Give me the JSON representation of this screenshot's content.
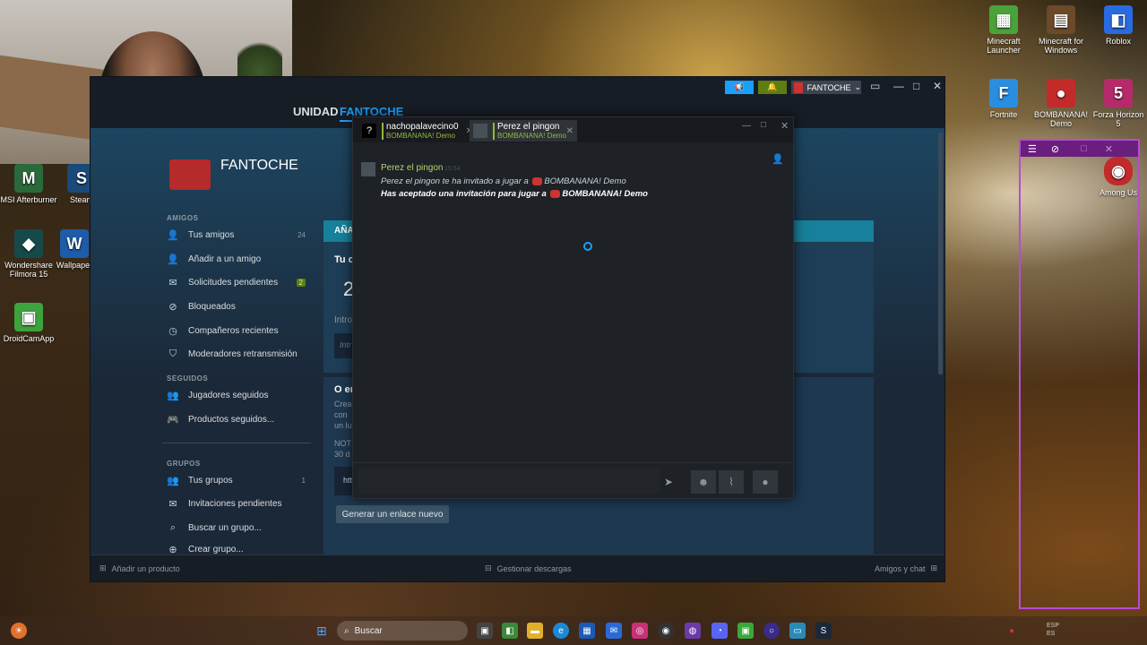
{
  "desktop": {
    "icons_left": [
      {
        "label": "MSI Afterburner",
        "icon": "msi-afterburner-icon"
      },
      {
        "label": "Steam",
        "icon": "steam-icon"
      },
      {
        "label": "Wondershare Filmora 15",
        "icon": "filmora-icon"
      },
      {
        "label": "Wallpaper",
        "icon": "wallpaper-engine-icon"
      },
      {
        "label": "DroidCamApp",
        "icon": "droidcam-icon"
      }
    ],
    "icons_right": [
      {
        "label": "Minecraft Launcher",
        "icon": "minecraft-launcher-icon"
      },
      {
        "label": "Minecraft for Windows",
        "icon": "minecraft-windows-icon"
      },
      {
        "label": "Roblox",
        "icon": "roblox-icon"
      },
      {
        "label": "Fortnite",
        "icon": "fortnite-icon"
      },
      {
        "label": "BOMBANANA! Demo",
        "icon": "bombanana-icon"
      },
      {
        "label": "Forza Horizon 5",
        "icon": "forza-icon"
      },
      {
        "label": "Among Us",
        "icon": "among-us-icon"
      }
    ]
  },
  "steam": {
    "nav": {
      "community": "UNIDAD",
      "profile": "FANTOCHE"
    },
    "account": {
      "name": "FANTOCHE"
    },
    "profile_name": "FANTOCHE",
    "sidebar": {
      "friends_header": "AMIGOS",
      "friends_items": [
        {
          "label": "Tus amigos",
          "count": "24"
        },
        {
          "label": "Añadir a un amigo",
          "count": ""
        },
        {
          "label": "Solicitudes pendientes",
          "count": "2"
        },
        {
          "label": "Bloqueados",
          "count": ""
        },
        {
          "label": "Compañeros recientes",
          "count": ""
        },
        {
          "label": "Moderadores retransmisión",
          "count": ""
        }
      ],
      "following_header": "SEGUIDOS",
      "following_items": [
        {
          "label": "Jugadores seguidos"
        },
        {
          "label": "Productos seguidos..."
        }
      ],
      "groups_header": "GRUPOS",
      "groups_items": [
        {
          "label": "Tus grupos",
          "count": "1"
        },
        {
          "label": "Invitaciones pendientes",
          "count": ""
        },
        {
          "label": "Buscar un grupo...",
          "count": ""
        },
        {
          "label": "Crear grupo...",
          "count": ""
        }
      ]
    },
    "main": {
      "banner_fragment": "AÑA",
      "code_label_fragment": "Tu c",
      "code_fragment": "2",
      "intro_fragment": "Intro",
      "input_fragment": "Intr",
      "or_fragment": "O er",
      "create_fragment_1": "Crea",
      "create_fragment_2": "con",
      "create_fragment_3": "un lu",
      "note_fragment_1": "NOT",
      "note_fragment_2": "30 d",
      "link_fragment": "htt",
      "generate_button": "Generar un enlace nuevo"
    },
    "bottom": {
      "add_product": "Añadir un producto",
      "manage_downloads": "Gestionar descargas",
      "friends_chat": "Amigos y chat"
    }
  },
  "chat": {
    "tabs": [
      {
        "name": "nachopalavecino0",
        "status": "BOMBANANA! Demo",
        "avatar": "?"
      },
      {
        "name": "Perez el pingon",
        "status": "BOMBANANA! Demo",
        "avatar": ""
      }
    ],
    "message": {
      "sender": "Perez el pingon",
      "time": "15:54",
      "line1_prefix": "Perez el pingon te ha invitado a jugar a",
      "line1_game": "BOMBANANA! Demo",
      "line2_prefix": "Has aceptado una invitación para jugar a",
      "line2_game": "BOMBANANA! Demo"
    }
  },
  "taskbar": {
    "search_placeholder": "Buscar",
    "tray_lang": "ESP",
    "tray_region": "ES"
  },
  "colors": {
    "steam_bg": "#1b2838",
    "steam_accent": "#1a9fff",
    "online_green": "#90ba3c",
    "overlay_purple": "#b84bd6"
  }
}
